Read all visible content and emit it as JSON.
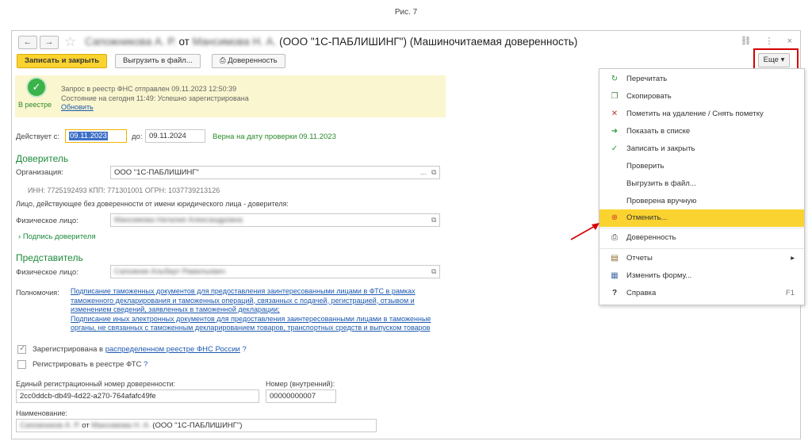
{
  "caption": "Рис. 7",
  "header": {
    "back": "←",
    "forward": "→",
    "title_person1": "Сапожникова А. Р.",
    "title_from": "от",
    "title_person2": "Мансимова Н. А.",
    "title_org": "(ООО \"1С-ПАБЛИШИНГ\") (Машиночитаемая доверенность)",
    "link_icon": "⛓",
    "more_icon": "⋮",
    "close_icon": "×"
  },
  "toolbar": {
    "save_close": "Записать и закрыть",
    "export": "Выгрузить в файл...",
    "print": "Доверенность",
    "more": "Еще ▾"
  },
  "status": {
    "label": "В реестре",
    "line1": "Запрос в реестр ФНС отправлен 09.11.2023 12:50:39",
    "line2": "Состояние на сегодня 11:49: Успешно зарегистрирована",
    "refresh": "Обновить"
  },
  "validity": {
    "from_label": "Действует с:",
    "from_value": "09.11.2023",
    "to_label": "до:",
    "to_value": "09.11.2024",
    "check_text": "Верна на дату проверки 09.11.2023"
  },
  "principal": {
    "section": "Доверитель",
    "org_label": "Организация:",
    "org_value": "ООО \"1С-ПАБЛИШИНГ\"",
    "ids": "ИНН: 7725192493 КПП: 771301001 ОГРН: 1037739213126",
    "without_poa": "Лицо, действующее без доверенности от имени юридического лица - доверителя:",
    "person_label": "Физическое лицо:",
    "person_value": "Мансимова Наталия Александровна",
    "signature": "Подпись доверителя"
  },
  "representative": {
    "section": "Представитель",
    "person_label": "Физическое лицо:",
    "person_value": "Сапожник Альберт Рамильевич"
  },
  "authority": {
    "label": "Полномочия:",
    "lines": [
      "Подписание таможенных документов для предоставления заинтересованными лицами в ФТС в рамках",
      "таможенного декларирования и таможенных операций, связанных с подачей, регистрацией, отзывом и",
      "изменением сведений, заявленных в таможенной декларации;",
      "Подписание иных электронных документов для предоставления заинтересованными лицами в таможенные",
      "органы, не связанных с таможенным декларированием товаров, транспортных средств и выпуском товаров"
    ]
  },
  "registry": {
    "registered_prefix": "Зарегистрирована в",
    "registered_link": "распределенном реестре ФНС России",
    "help": "?",
    "register_fts": "Регистрировать в реестре ФТС"
  },
  "numbers": {
    "unified_label": "Единый регистрационный номер доверенности:",
    "unified_value": "2cc0ddcb-db49-4d22-a270-764afafc49fe",
    "internal_label": "Номер (внутренний):",
    "internal_value": "00000000007"
  },
  "name": {
    "label": "Наименование:",
    "value_person1": "Сапожников А. Р.",
    "value_from": "от",
    "value_person2": "Мансимова Н. А.",
    "value_org": "(ООО \"1С-ПАБЛИШИНГ\")"
  },
  "menu": {
    "items": [
      {
        "icon": "↻",
        "label": "Перечитать",
        "shortcut": ""
      },
      {
        "icon": "❐",
        "label": "Скопировать",
        "shortcut": ""
      },
      {
        "icon": "✕",
        "label": "Пометить на удаление / Снять пометку",
        "shortcut": ""
      },
      {
        "icon": "➜",
        "label": "Показать в списке",
        "shortcut": ""
      },
      {
        "icon": "✓",
        "label": "Записать и закрыть",
        "shortcut": ""
      },
      {
        "icon": "",
        "label": "Проверить",
        "shortcut": ""
      },
      {
        "icon": "",
        "label": "Выгрузить в файл...",
        "shortcut": ""
      },
      {
        "icon": "",
        "label": "Проверена вручную",
        "shortcut": ""
      },
      {
        "icon": "⊗",
        "label": "Отменить...",
        "shortcut": ""
      },
      {
        "icon": "⎙",
        "label": "Доверенность",
        "shortcut": ""
      },
      {
        "icon": "▤",
        "label": "Отчеты",
        "shortcut": "▸"
      },
      {
        "icon": "▦",
        "label": "Изменить форму...",
        "shortcut": ""
      },
      {
        "icon": "?",
        "label": "Справка",
        "shortcut": "F1"
      }
    ]
  },
  "colors": {
    "accent_yellow": "#fad330",
    "highlight_red": "#d50000",
    "link_blue": "#1e5ab0",
    "section_green": "#1e8a3c"
  }
}
